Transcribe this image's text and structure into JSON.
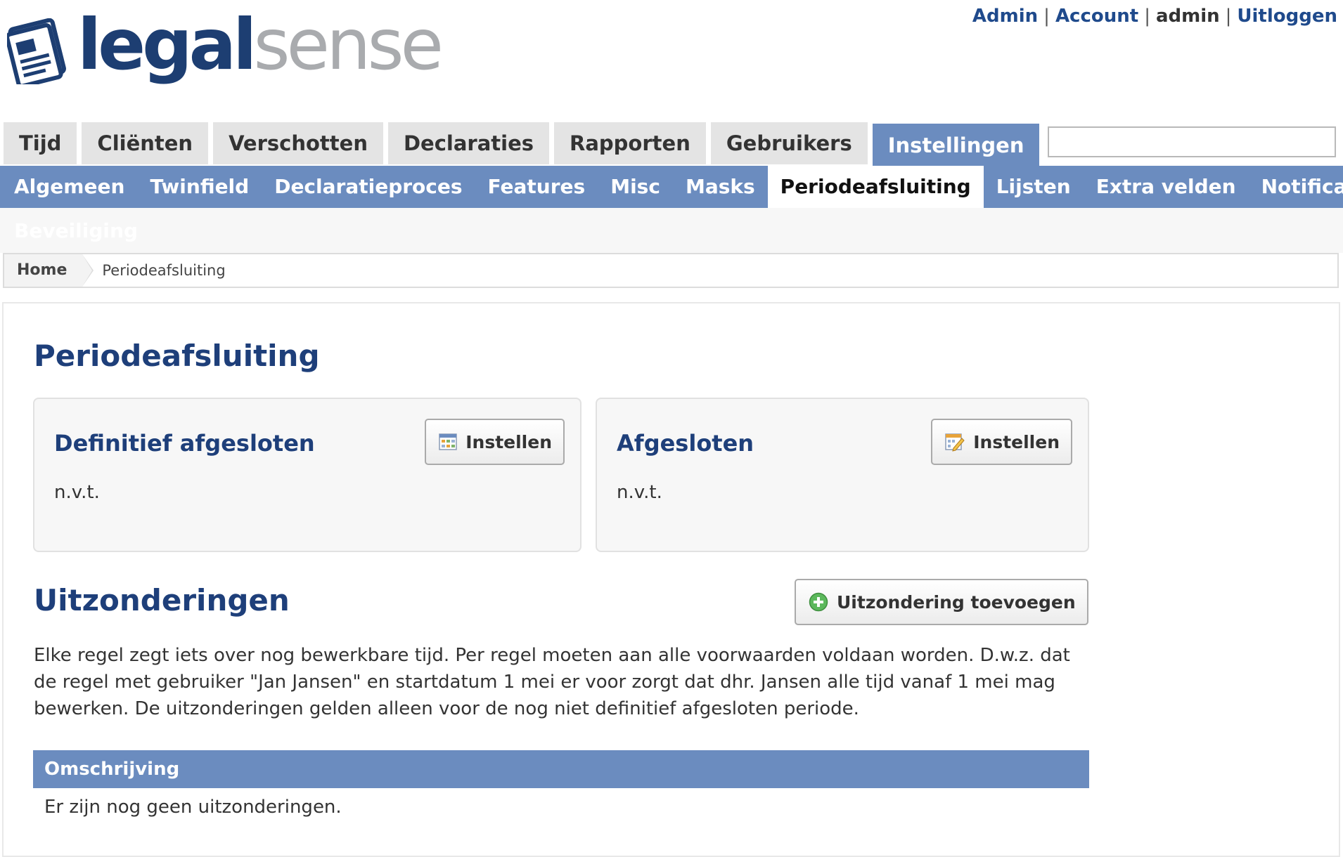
{
  "top_links": {
    "admin": "Admin",
    "account": "Account",
    "user": "admin",
    "logout": "Uitloggen",
    "separator": "|"
  },
  "logo": {
    "part1": "legal",
    "part2": "sense",
    "icon": "document-stack-icon"
  },
  "main_nav": [
    {
      "label": "Tijd"
    },
    {
      "label": "Cliënten"
    },
    {
      "label": "Verschotten"
    },
    {
      "label": "Declaraties"
    },
    {
      "label": "Rapporten"
    },
    {
      "label": "Gebruikers"
    },
    {
      "label": "Instellingen",
      "active": true
    }
  ],
  "search": {
    "value": "",
    "placeholder": ""
  },
  "sub_nav": [
    {
      "label": "Algemeen"
    },
    {
      "label": "Twinfield"
    },
    {
      "label": "Declaratieproces"
    },
    {
      "label": "Features"
    },
    {
      "label": "Misc"
    },
    {
      "label": "Masks"
    },
    {
      "label": "Periodeafsluiting",
      "active": true
    },
    {
      "label": "Lijsten"
    },
    {
      "label": "Extra velden"
    },
    {
      "label": "Notificaties"
    }
  ],
  "sub_nav_overflow": "Beveiliging",
  "breadcrumb": {
    "home": "Home",
    "current": "Periodeafsluiting"
  },
  "page_title": "Periodeafsluiting",
  "panels": {
    "definitief": {
      "title": "Definitief afgesloten",
      "value": "n.v.t.",
      "button": "Instellen",
      "icon": "calendar-icon"
    },
    "afgesloten": {
      "title": "Afgesloten",
      "value": "n.v.t.",
      "button": "Instellen",
      "icon": "calendar-edit-icon"
    }
  },
  "exceptions": {
    "title": "Uitzonderingen",
    "add_button": "Uitzondering toevoegen",
    "add_icon": "add-circle-icon",
    "description": "Elke regel zegt iets over nog bewerkbare tijd. Per regel moeten aan alle voorwaarden voldaan worden. D.w.z. dat de regel met gebruiker \"Jan Jansen\" en startdatum 1 mei er voor zorgt dat dhr. Jansen alle tijd vanaf 1 mei mag bewerken. De uitzonderingen gelden alleen voor de nog niet definitief afgesloten periode.",
    "table_header": "Omschrijving",
    "empty_text": "Er zijn nog geen uitzonderingen."
  },
  "colors": {
    "brand_dark": "#1d3e72",
    "brand_grey": "#a9abae",
    "nav_blue": "#6b8cbf",
    "heading_blue": "#1e3f7a",
    "link_blue": "#1f4a8c"
  }
}
